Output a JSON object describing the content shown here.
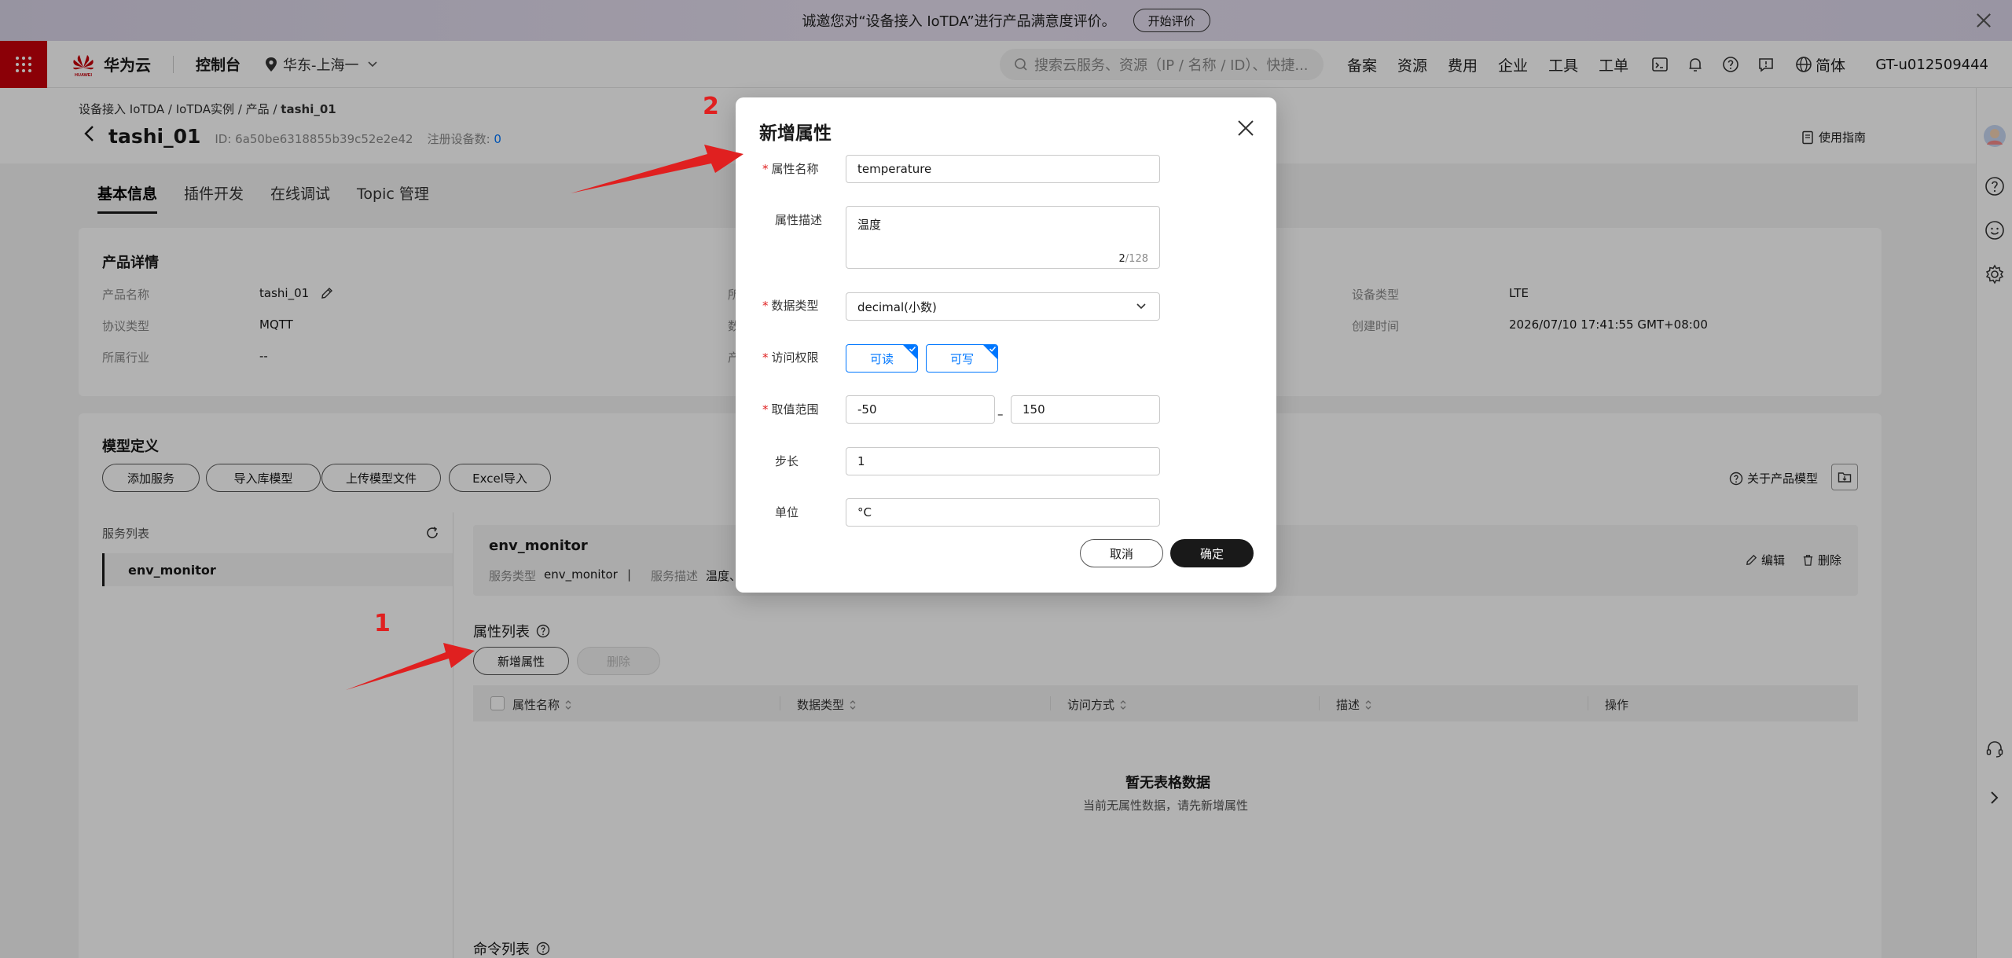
{
  "banner": {
    "text": "诚邀您对“设备接入 IoTDA”进行产品满意度评价。",
    "button": "开始评价"
  },
  "topnav": {
    "brand_logo_text": "HUAWEI",
    "brand": "华为云",
    "console": "控制台",
    "region": "华东-上海一",
    "search_placeholder": "搜索云服务、资源（IP / 名称 / ID）、快捷...",
    "links": [
      "备案",
      "资源",
      "费用",
      "企业",
      "工具",
      "工单"
    ],
    "language": "简体",
    "account": "GT-u012509444"
  },
  "breadcrumb": {
    "items": [
      "设备接入 IoTDA",
      "IoTDA实例",
      "产品"
    ],
    "current": "tashi_01",
    "sep": "/"
  },
  "header": {
    "title": "tashi_01",
    "id_label": "ID: 6a50be6318855b39c52e2e42",
    "device_count_label": "注册设备数:",
    "device_count": "0",
    "guide": "使用指南"
  },
  "tabs": [
    "基本信息",
    "插件开发",
    "在线调试",
    "Topic 管理"
  ],
  "product_details": {
    "title": "产品详情",
    "left": [
      {
        "label": "产品名称",
        "value": "tashi_01"
      },
      {
        "label": "协议类型",
        "value": "MQTT"
      },
      {
        "label": "所属行业",
        "value": "--"
      }
    ],
    "middle_labels": [
      "所",
      "数",
      "产"
    ],
    "right": [
      {
        "label": "设备类型",
        "value": "LTE"
      },
      {
        "label": "创建时间",
        "value": "2026/07/10 17:41:55 GMT+08:00"
      }
    ]
  },
  "model": {
    "title": "模型定义",
    "buttons": [
      "添加服务",
      "导入库模型",
      "上传模型文件",
      "Excel导入"
    ],
    "about": "关于产品模型",
    "service_list_title": "服务列表",
    "service_item": "env_monitor",
    "service": {
      "name": "env_monitor",
      "type_label": "服务类型",
      "type_value": "env_monitor",
      "sep": "|",
      "desc_label": "服务描述",
      "desc_value": "温度、",
      "edit": "编辑",
      "delete": "删除"
    },
    "prop_list_title": "属性列表",
    "add_prop": "新增属性",
    "delete_prop": "删除",
    "columns": [
      "属性名称",
      "数据类型",
      "访问方式",
      "描述",
      "操作"
    ],
    "empty_title": "暂无表格数据",
    "empty_sub": "当前无属性数据，请先新增属性",
    "cmd_list_title": "命令列表"
  },
  "dialog": {
    "title": "新增属性",
    "required_mark": "*",
    "fields": {
      "name_label": "属性名称",
      "name_value": "temperature",
      "desc_label": "属性描述",
      "desc_value": "温度",
      "desc_count": "2",
      "desc_max": "/128",
      "type_label": "数据类型",
      "type_value": "decimal(小数)",
      "access_label": "访问权限",
      "access_read": "可读",
      "access_write": "可写",
      "range_label": "取值范围",
      "range_min": "-50",
      "range_dash": "–",
      "range_max": "150",
      "step_label": "步长",
      "step_value": "1",
      "unit_label": "单位",
      "unit_value": "°C"
    },
    "cancel": "取消",
    "ok": "确定"
  },
  "annotations": {
    "one": "1",
    "two": "2",
    "color": "#e02020"
  },
  "colors": {
    "brand_red": "#c7000b",
    "link_blue": "#0077ff",
    "primary_black": "#191919"
  }
}
